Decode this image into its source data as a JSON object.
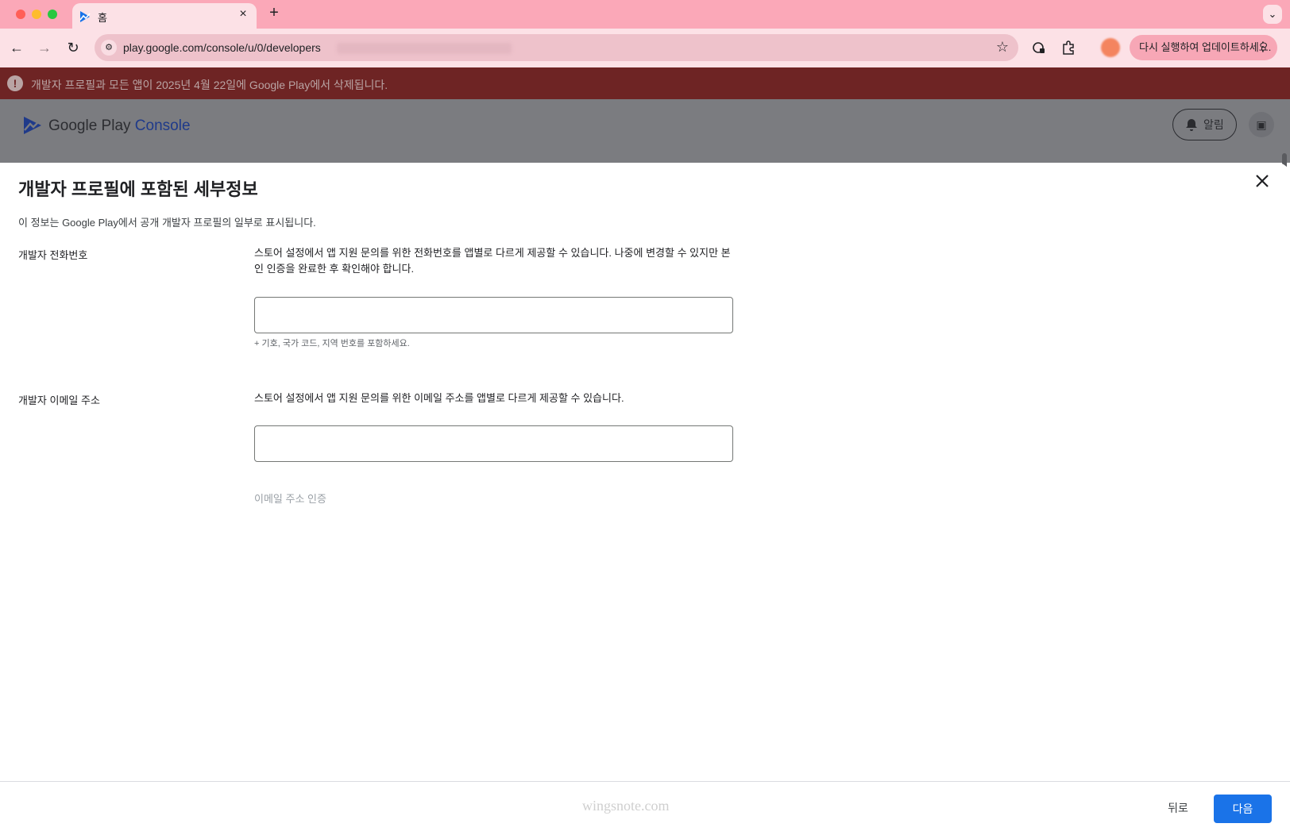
{
  "browser": {
    "tab_title": "홈",
    "tab_close": "×",
    "new_tab": "+",
    "tab_search": "⌄",
    "url": "play.google.com/console/u/0/developers",
    "update_label": "다시 실행하여 업데이트하세요.",
    "menu_dots": "⋮",
    "back": "←",
    "forward": "→",
    "reload": "↻",
    "star": "☆"
  },
  "banner": {
    "icon": "!",
    "text": "개발자 프로필과 모든 앱이 2025년 4월 22일에 Google Play에서 삭제됩니다."
  },
  "console": {
    "brand_google_play": "Google Play",
    "brand_console": "Console",
    "alert_label": "알림"
  },
  "dialog": {
    "title": "개발자 프로필에 포함된 세부정보",
    "subtitle": "이 정보는 Google Play에서 공개 개발자 프로필의 일부로 표시됩니다.",
    "phone": {
      "label": "개발자 전화번호",
      "description": "스토어 설정에서 앱 지원 문의를 위한 전화번호를 앱별로 다르게 제공할 수 있습니다. 나중에 변경할 수 있지만 본인 인증을 완료한 후 확인해야 합니다.",
      "value": "",
      "helper": "+ 기호, 국가 코드, 지역 번호를 포함하세요."
    },
    "email": {
      "label": "개발자 이메일 주소",
      "description": "스토어 설정에서 앱 지원 문의를 위한 이메일 주소를 앱별로 다르게 제공할 수 있습니다.",
      "value": "",
      "verify_label": "이메일 주소 인증"
    }
  },
  "footer": {
    "watermark": "wingsnote.com",
    "back_label": "뒤로",
    "next_label": "다음"
  },
  "colors": {
    "tab_strip": "#fba8b8",
    "banner": "#6e2424",
    "primary": "#1a73e8"
  },
  "icons": [
    "play-console-icon",
    "warning-icon",
    "bell-icon",
    "help-icon",
    "close-icon",
    "star-icon",
    "extensions-icon",
    "password-manager-icon"
  ]
}
